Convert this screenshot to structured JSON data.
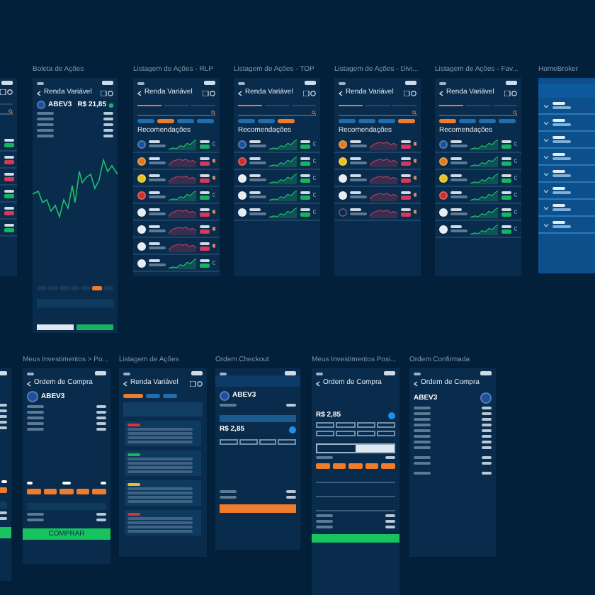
{
  "frames": [
    {
      "kind": "list",
      "rows": [
        {
          "rising": true
        },
        {
          "rising": false
        },
        {
          "rising": false
        },
        {
          "rising": true
        },
        {
          "rising": false
        },
        {
          "rising": true
        }
      ]
    },
    {
      "kind": "boleta",
      "title": "Boleta de Ações",
      "header": "Renda Variável",
      "ticker": "ABEV3",
      "price": "R$ 21,85"
    },
    {
      "kind": "list",
      "title": "Listagem de Ações - RLP",
      "header": "Renda Variável",
      "section": "Recomendações",
      "tabs": [
        {
          "selected": true
        },
        {
          "selected": false
        },
        {
          "selected": false
        }
      ],
      "chips": [
        {
          "selected": false
        },
        {
          "selected": true
        },
        {
          "selected": false
        },
        {
          "selected": false
        }
      ],
      "rows": [
        {
          "color": "#1d4f9c",
          "rising": true
        },
        {
          "color": "#e07a1a",
          "rising": false
        },
        {
          "color": "#e8c21a",
          "rising": false
        },
        {
          "color": "#d42a2a",
          "rising": true
        },
        {
          "color": "#e8ecef",
          "rising": false
        },
        {
          "color": "#e8ecef",
          "rising": false
        },
        {
          "color": "#e8ecef",
          "rising": false
        },
        {
          "color": "#e8ecef",
          "rising": true
        }
      ]
    },
    {
      "kind": "list",
      "title": "Listagem de Ações - TOP",
      "header": "Renda Variável",
      "section": "Recomendações",
      "tabs": [
        {
          "selected": true
        },
        {
          "selected": false
        },
        {
          "selected": false
        }
      ],
      "chips": [
        {
          "selected": false
        },
        {
          "selected": false
        },
        {
          "selected": true
        }
      ],
      "rows": [
        {
          "color": "#1d4f9c",
          "rising": true
        },
        {
          "color": "#d42a2a",
          "rising": true
        },
        {
          "color": "#e8ecef",
          "rising": true
        },
        {
          "color": "#e8ecef",
          "rising": true
        },
        {
          "color": "#e8ecef",
          "rising": true
        }
      ]
    },
    {
      "kind": "list",
      "title": "Listagem de Ações - Divi...",
      "header": "Renda Variável",
      "section": "Recomendações",
      "tabs": [
        {
          "selected": true
        },
        {
          "selected": false
        },
        {
          "selected": false
        }
      ],
      "chips": [
        {
          "selected": false
        },
        {
          "selected": false
        },
        {
          "selected": false
        },
        {
          "selected": true
        }
      ],
      "rows": [
        {
          "color": "#e07a1a",
          "rising": false
        },
        {
          "color": "#e8c21a",
          "rising": false
        },
        {
          "color": "#e8ecef",
          "rising": false
        },
        {
          "color": "#e8ecef",
          "rising": false
        },
        {
          "color": "#14204a",
          "rising": false
        }
      ]
    },
    {
      "kind": "list",
      "title": "Listagem de Ações - Fav...",
      "header": "Renda Variável",
      "section": "Recomendações",
      "tabs": [
        {
          "selected": true
        },
        {
          "selected": false
        },
        {
          "selected": false
        }
      ],
      "chips": [
        {
          "selected": true
        },
        {
          "selected": false
        },
        {
          "selected": false
        },
        {
          "selected": false
        }
      ],
      "rows": [
        {
          "color": "#1d4f9c",
          "rising": true
        },
        {
          "color": "#e07a1a",
          "rising": true
        },
        {
          "color": "#e8c21a",
          "rising": true
        },
        {
          "color": "#d42a2a",
          "rising": true
        },
        {
          "color": "#e8ecef",
          "rising": true
        },
        {
          "color": "#e8ecef",
          "rising": true
        }
      ]
    },
    {
      "kind": "homebroker",
      "title": "HomeBroker"
    },
    {
      "kind": "order"
    },
    {
      "kind": "order",
      "title": "Meus Investimentos > Po...",
      "header": "Ordem de Compra",
      "ticker": "ABEV3",
      "button": "COMPRAR"
    },
    {
      "kind": "cards",
      "title": "Listagem de Ações",
      "header": "Renda Variável",
      "cards": [
        {
          "color": "#d9343a"
        },
        {
          "color": "#16b85a"
        },
        {
          "color": "#e8c21a"
        },
        {
          "color": "#d9343a"
        }
      ]
    },
    {
      "kind": "checkout",
      "title": "Ordem Checkout",
      "ticker": "ABEV3",
      "price": "R$ 2,85"
    },
    {
      "kind": "position",
      "title": "Meus Investimentos Posi...",
      "header": "Ordem de Compra",
      "price": "R$ 2,85"
    },
    {
      "kind": "confirm",
      "title": "Ordem Confirmada",
      "header": "Ordem de Compra",
      "ticker": "ABEV3"
    }
  ]
}
